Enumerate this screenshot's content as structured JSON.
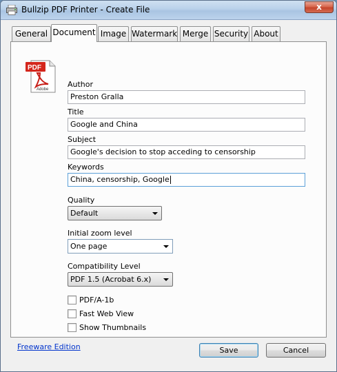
{
  "window": {
    "title": "Bullzip PDF Printer - Create File",
    "close_glyph": "x"
  },
  "tabs": [
    {
      "label": "General",
      "active": false
    },
    {
      "label": "Document",
      "active": true
    },
    {
      "label": "Image",
      "active": false
    },
    {
      "label": "Watermark",
      "active": false
    },
    {
      "label": "Merge",
      "active": false
    },
    {
      "label": "Security",
      "active": false
    },
    {
      "label": "About",
      "active": false
    }
  ],
  "icon": {
    "name": "pdf-adobe-icon",
    "badge_text": "PDF",
    "caption": "Adobe",
    "badge_color": "#d4261c"
  },
  "document": {
    "author_label": "Author",
    "author_value": "Preston Gralla",
    "title_label": "Title",
    "title_value": "Google and China",
    "subject_label": "Subject",
    "subject_value": "Google's decision to stop acceding to censorship",
    "keywords_label": "Keywords",
    "keywords_value": "China, censorship, Google",
    "quality_label": "Quality",
    "quality_value": "Default",
    "zoom_label": "Initial zoom level",
    "zoom_value": "One page",
    "compat_label": "Compatibility Level",
    "compat_value": "PDF 1.5 (Acrobat 6.x)",
    "pdfa_label": "PDF/A-1b",
    "pdfa_checked": false,
    "fastweb_label": "Fast Web View",
    "fastweb_checked": false,
    "thumbs_label": "Show Thumbnails",
    "thumbs_checked": false
  },
  "footer": {
    "edition_link": "Freeware Edition",
    "save_label": "Save",
    "cancel_label": "Cancel"
  }
}
